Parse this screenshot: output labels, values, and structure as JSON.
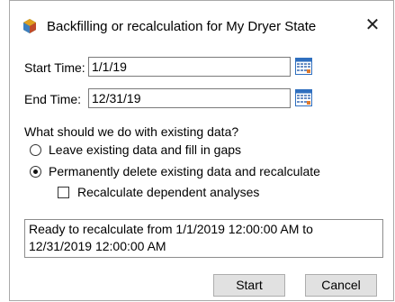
{
  "window": {
    "title": "Backfilling or recalculation for My Dryer State",
    "close_glyph": "✕"
  },
  "start_time": {
    "label": "Start Time:",
    "value": "1/1/19",
    "icon": "calendar-icon"
  },
  "end_time": {
    "label": "End Time:",
    "value": "12/31/19",
    "icon": "calendar-icon"
  },
  "existing_data": {
    "question": "What should we do with existing data?",
    "options": [
      {
        "label": "Leave existing data and fill in gaps",
        "selected": false
      },
      {
        "label": "Permanently delete existing data and recalculate",
        "selected": true
      }
    ],
    "recalc_dependent": {
      "label": "Recalculate dependent analyses",
      "checked": false
    }
  },
  "status": {
    "line1": "Ready to recalculate from 1/1/2019 12:00:00 AM to",
    "line2": "12/31/2019 12:00:00 AM"
  },
  "buttons": {
    "start": "Start",
    "cancel": "Cancel"
  },
  "colors": {
    "calendar_blue": "#2f6fbf",
    "calendar_orange": "#e07a2c"
  }
}
